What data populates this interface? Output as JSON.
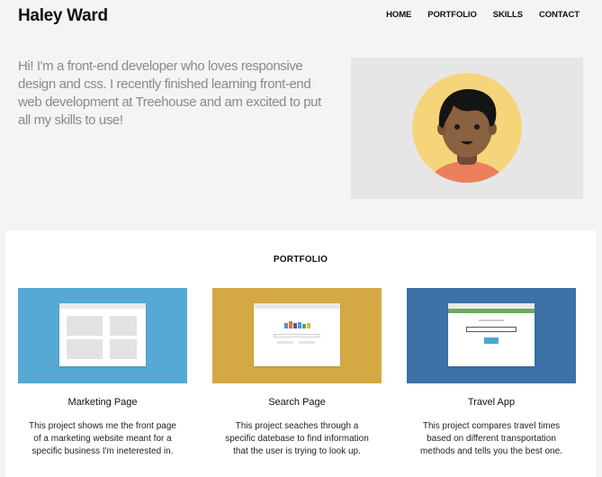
{
  "header": {
    "brand": "Haley Ward",
    "nav": [
      "HOME",
      "PORTFOLIO",
      "SKILLS",
      "CONTACT"
    ]
  },
  "intro": {
    "text": "Hi! I'm a front-end developer who loves responsive design and css. I recently finished learning front-end web development at Treehouse and am excited to put all my skills to use!"
  },
  "portfolio": {
    "title": "PORTFOLIO",
    "projects": [
      {
        "title": "Marketing Page",
        "description": "This project shows me the front page of a marketing website meant for a specific business I'm ineterested in.",
        "color": "#56a9d3"
      },
      {
        "title": "Search Page",
        "description": "This project seaches through a specific datebase to find information that the user is trying to look up.",
        "color": "#d4a843"
      },
      {
        "title": "Travel App",
        "description": "This project compares travel times based on different transportation methods and tells you the best one.",
        "color": "#3d72a8"
      }
    ]
  },
  "colors": {
    "background": "#f5f3f3",
    "avatar_bg": "#f6d57a",
    "skin": "#8a6242",
    "shirt": "#ea7f5c"
  }
}
